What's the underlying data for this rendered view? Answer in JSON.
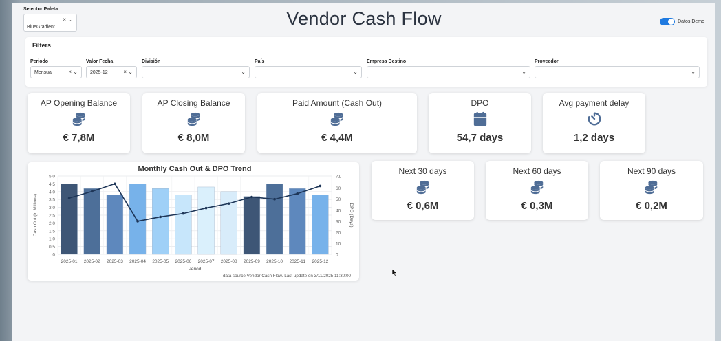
{
  "header": {
    "palette_label": "Selector Paleta",
    "palette_value": "BlueGradient",
    "palette_controls": "× ⌄",
    "title": "Vendor Cash Flow",
    "demo_label": "Datos Demo",
    "demo_enabled": true,
    "accent": "#1f7ae0"
  },
  "filters": {
    "heading": "Filters",
    "fields": [
      {
        "label": "Periodo",
        "value": "Mensual",
        "controls": "× ⌄"
      },
      {
        "label": "Valor Fecha",
        "value": "2025-12",
        "controls": "× ⌄"
      },
      {
        "label": "División",
        "value": "",
        "controls": "⌄"
      },
      {
        "label": "País",
        "value": "",
        "controls": "⌄"
      },
      {
        "label": "Empresa Destino",
        "value": "",
        "controls": "⌄"
      },
      {
        "label": "Proveedor",
        "value": "",
        "controls": "⌄"
      }
    ]
  },
  "kpis": [
    {
      "title": "AP Opening Balance",
      "value": "€ 7,8M",
      "icon": "coins-icon"
    },
    {
      "title": "AP Closing Balance",
      "value": "€ 8,0M",
      "icon": "coins-icon"
    },
    {
      "title": "Paid Amount (Cash Out)",
      "value": "€ 4,4M",
      "icon": "coins-icon"
    },
    {
      "title": "DPO",
      "value": "54,7 days",
      "icon": "calendar-icon"
    },
    {
      "title": "Avg payment delay",
      "value": "1,2 days",
      "icon": "timer-icon"
    }
  ],
  "forecast": [
    {
      "title": "Next 30 days",
      "value": "€ 0,6M",
      "icon": "coins-icon"
    },
    {
      "title": "Next 60 days",
      "value": "€ 0,3M",
      "icon": "coins-icon"
    },
    {
      "title": "Next 90 days",
      "value": "€ 0,2M",
      "icon": "coins-icon"
    }
  ],
  "icon_color": "#4f6d96",
  "chart_data": {
    "type": "bar",
    "title": "Monthly Cash Out & DPO Trend",
    "xlabel": "Period",
    "ylabel": "Cash Out (in Millions)",
    "y2label": "DPO (Days)",
    "categories": [
      "2025-01",
      "2025-02",
      "2025-03",
      "2025-04",
      "2025-05",
      "2025-06",
      "2025-07",
      "2025-08",
      "2025-09",
      "2025-10",
      "2025-11",
      "2025-12"
    ],
    "series": [
      {
        "type": "bar",
        "axis": "left",
        "values": [
          4.5,
          4.2,
          3.8,
          4.5,
          4.2,
          3.8,
          4.3,
          4.0,
          3.7,
          4.5,
          4.2,
          3.8
        ]
      },
      {
        "type": "line",
        "axis": "right",
        "values": [
          51,
          57,
          64,
          30,
          34,
          37,
          42,
          46,
          52,
          50,
          55,
          62
        ]
      }
    ],
    "bar_colors": [
      "#3e5676",
      "#4d6f99",
      "#5e88bd",
      "#77b2ea",
      "#9fd0f7",
      "#c7e6fb",
      "#daf0fc",
      "#d8ecfa",
      "#3e5676",
      "#4d6f99",
      "#5e88bd",
      "#77b2ea"
    ],
    "line_color": "#1d3557",
    "ylim": [
      0,
      5
    ],
    "y_ticks": [
      "0",
      "0,5",
      "1,0",
      "1,5",
      "2,0",
      "2,5",
      "3,0",
      "3,5",
      "4,0",
      "4,5",
      "5,0"
    ],
    "y2lim": [
      0,
      71
    ],
    "y2_ticks": [
      "0",
      "10",
      "20",
      "30",
      "40",
      "50",
      "60",
      "71"
    ],
    "grid": true,
    "footnote": "data source Vendor Cash Flow. Last update on 3/11/2025 11:30:00"
  }
}
